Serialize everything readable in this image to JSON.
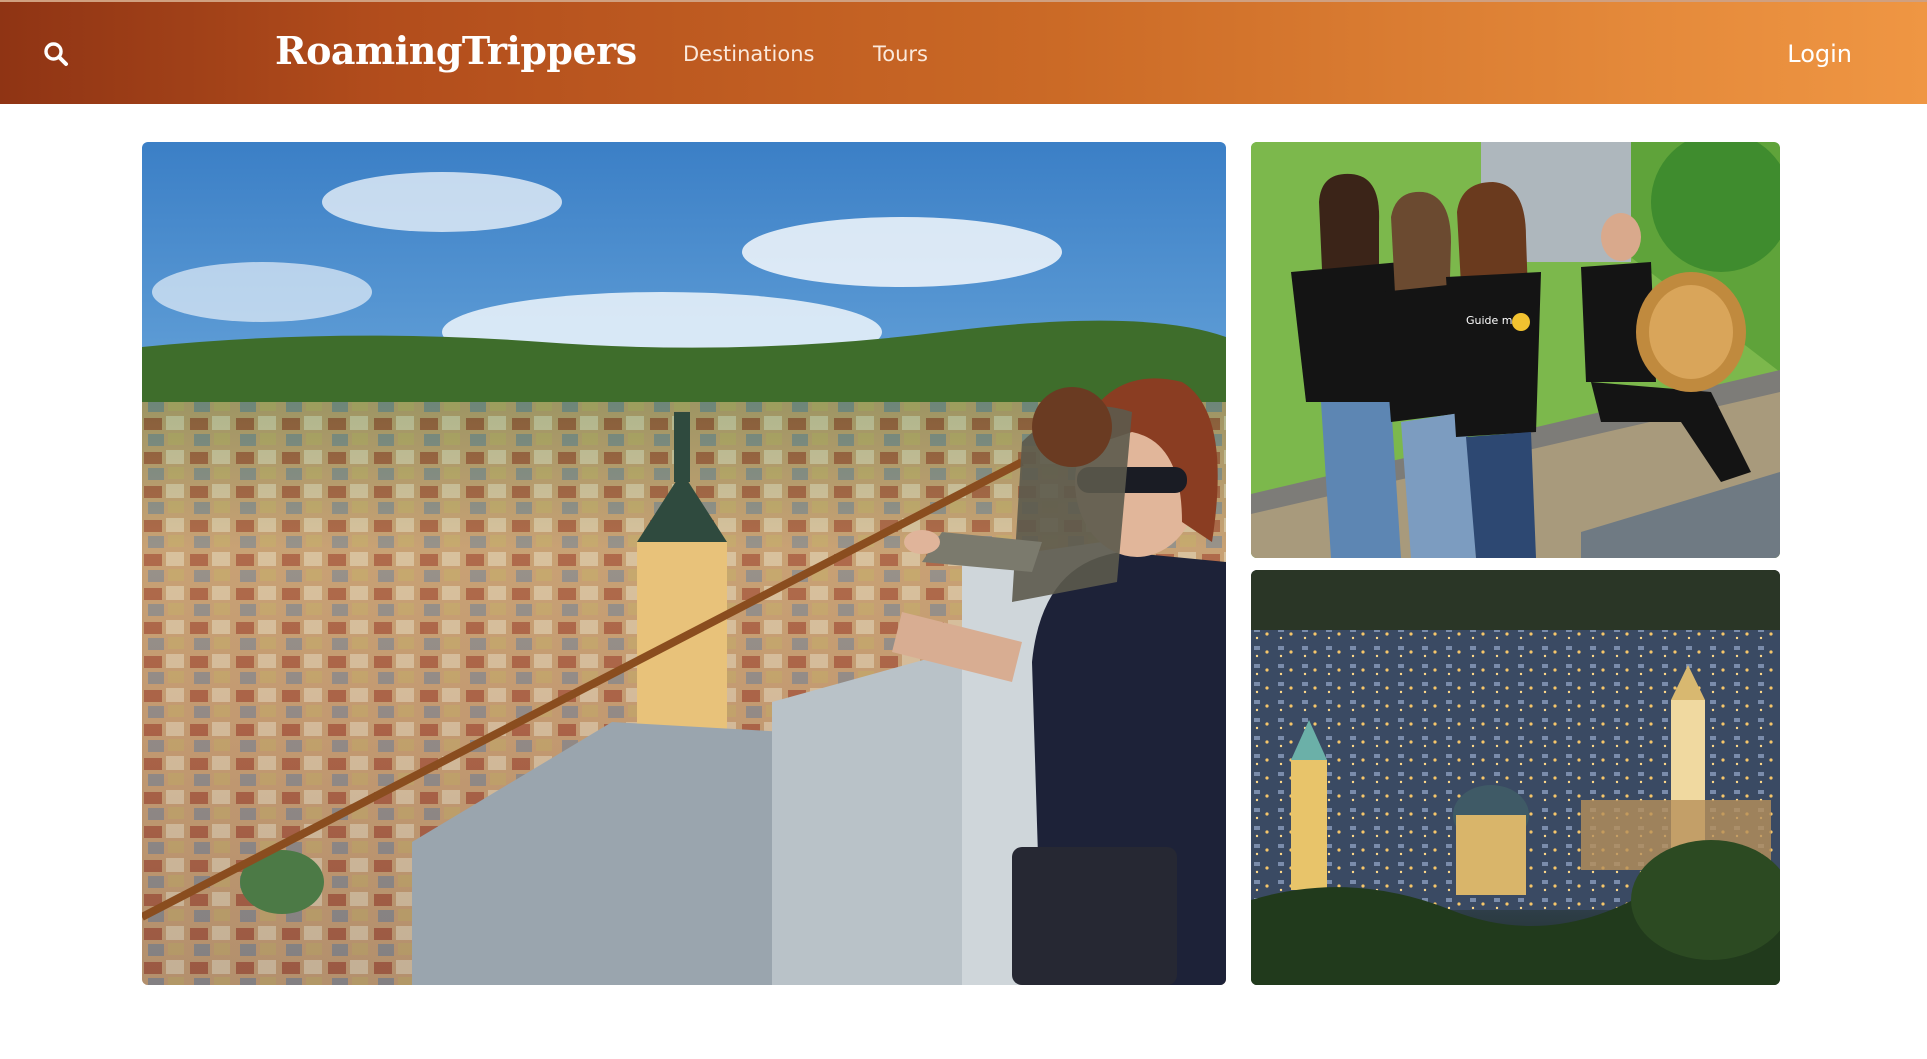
{
  "header": {
    "search_icon": "search-icon",
    "brand": "RoamingTrippers",
    "nav": [
      {
        "label": "Destinations"
      },
      {
        "label": "Tours"
      }
    ],
    "login_label": "Login",
    "colors": {
      "gradient_start": "#8f3414",
      "gradient_end": "#ef9643",
      "text": "#ffffff"
    }
  },
  "gallery": {
    "images": [
      {
        "description_tag": "city-rooftop-viewpoint-photo",
        "shirt_text": ""
      },
      {
        "description_tag": "tour-guides-group-photo",
        "shirt_text": "Guide me"
      },
      {
        "description_tag": "city-night-panorama-photo",
        "shirt_text": ""
      }
    ]
  }
}
